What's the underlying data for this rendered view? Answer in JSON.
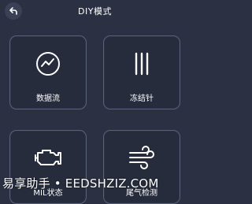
{
  "header": {
    "title": "DIY模式"
  },
  "cards": [
    {
      "label": "数据流",
      "icon": "data-stream-icon"
    },
    {
      "label": "冻结针",
      "icon": "freeze-frame-icon"
    },
    {
      "label": "MIL状态",
      "icon": "engine-icon"
    },
    {
      "label": "尾气检测",
      "icon": "emission-wind-icon"
    }
  ],
  "watermark": {
    "text": "易享助手 • EEDSHZIZ.COM"
  },
  "colors": {
    "background": "#2b3142",
    "card_border": "#59607a",
    "text": "#ffffff"
  }
}
